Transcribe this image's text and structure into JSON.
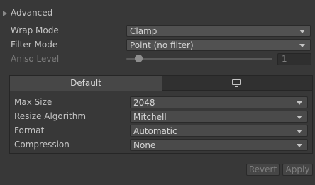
{
  "advanced": {
    "label": "Advanced"
  },
  "wrap_mode": {
    "label": "Wrap Mode",
    "value": "Clamp"
  },
  "filter_mode": {
    "label": "Filter Mode",
    "value": "Point (no filter)"
  },
  "aniso_level": {
    "label": "Aniso Level",
    "value": "1",
    "slider_fraction": 0.06
  },
  "platform_tabs": [
    {
      "label": "Default",
      "selected": true
    },
    {
      "label": "",
      "icon": "monitor-icon",
      "selected": false
    }
  ],
  "platform_settings": {
    "max_size": {
      "label": "Max Size",
      "value": "2048"
    },
    "resize_algorithm": {
      "label": "Resize Algorithm",
      "value": "Mitchell"
    },
    "format": {
      "label": "Format",
      "value": "Automatic"
    },
    "compression": {
      "label": "Compression",
      "value": "None"
    }
  },
  "buttons": {
    "revert": "Revert",
    "apply": "Apply"
  }
}
